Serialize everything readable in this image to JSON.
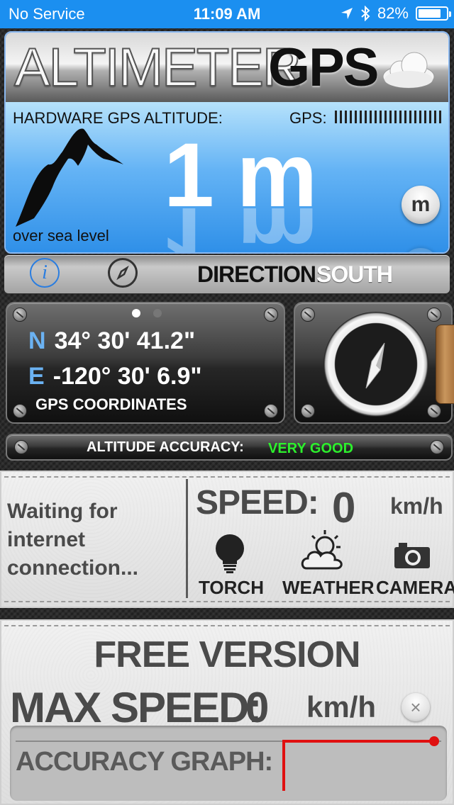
{
  "status_bar": {
    "carrier": "No Service",
    "time": "11:09 AM",
    "battery": "82%",
    "battery_level": 0.82
  },
  "header": {
    "logo_part1": "ALTIMETER",
    "logo_part2": "GPS"
  },
  "altitude": {
    "label": "HARDWARE GPS ALTITUDE:",
    "gps_label": "GPS:",
    "value": "1 m",
    "reference": "over sea level",
    "unit_button": "m"
  },
  "direction": {
    "label": "DIRECTION:",
    "value": "SOUTH"
  },
  "coordinates": {
    "lat_key": "N",
    "lat_value": "34° 30' 41.2\"",
    "lon_key": "E",
    "lon_value": "-120° 30' 6.9\"",
    "caption": "GPS COORDINATES",
    "page_count": 2,
    "active_page": 1
  },
  "accuracy": {
    "label": "ALTITUDE ACCURACY:",
    "value": "VERY GOOD",
    "value_color": "#2cf02c"
  },
  "weather_status": "Waiting for internet connection...",
  "speed": {
    "label": "SPEED:",
    "value": "0",
    "unit": "km/h"
  },
  "tools": {
    "torch": "TORCH",
    "weather": "WEATHER",
    "camera": "CAMERA"
  },
  "bottom": {
    "version": "FREE VERSION",
    "max_speed_label": "MAX SPEED:",
    "max_speed_value": "0",
    "max_speed_unit": "km/h",
    "reset_icon": "×",
    "graph_label": "ACCURACY GRAPH:"
  },
  "colors": {
    "status_bar": "#1b8ff0",
    "altitude_panel": "#2e8fe8",
    "info_accent": "#2a7de0",
    "graph_line": "#e01010"
  }
}
